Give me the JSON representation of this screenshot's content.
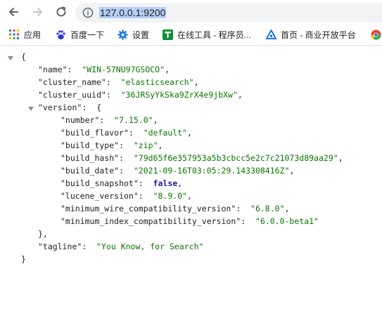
{
  "toolbar": {
    "url": "127.0.0.1:9200"
  },
  "bookmarks": [
    {
      "label": "应用",
      "icon": "apps-grid-icon"
    },
    {
      "label": "百度一下",
      "icon": "baidu-paw-icon"
    },
    {
      "label": "设置",
      "icon": "gear-icon"
    },
    {
      "label": "在线工具 - 程序员...",
      "icon": "t-logo-icon"
    },
    {
      "label": "首页 - 商业开放平台",
      "icon": "triangle-logo-icon"
    }
  ],
  "json": {
    "name_key": "\"name\"",
    "name_val": "\"WIN-57NU97GSOCO\"",
    "cluster_name_key": "\"cluster_name\"",
    "cluster_name_val": "\"elasticsearch\"",
    "cluster_uuid_key": "\"cluster_uuid\"",
    "cluster_uuid_val": "\"36JRSyYkSka9ZrX4e9jbXw\"",
    "version_key": "\"version\"",
    "number_key": "\"number\"",
    "number_val": "\"7.15.0\"",
    "build_flavor_key": "\"build_flavor\"",
    "build_flavor_val": "\"default\"",
    "build_type_key": "\"build_type\"",
    "build_type_val": "\"zip\"",
    "build_hash_key": "\"build_hash\"",
    "build_hash_val": "\"79d65f6e357953a5b3cbcc5e2c7c21073d89aa29\"",
    "build_date_key": "\"build_date\"",
    "build_date_val": "\"2021-09-16T03:05:29.143308416Z\"",
    "build_snapshot_key": "\"build_snapshot\"",
    "build_snapshot_val": "false",
    "lucene_version_key": "\"lucene_version\"",
    "lucene_version_val": "\"8.9.0\"",
    "min_wire_key": "\"minimum_wire_compatibility_version\"",
    "min_wire_val": "\"6.8.0\"",
    "min_index_key": "\"minimum_index_compatibility_version\"",
    "min_index_val": "\"6.0.0-beta1\"",
    "tagline_key": "\"tagline\"",
    "tagline_val": "\"You Know, for Search\""
  }
}
